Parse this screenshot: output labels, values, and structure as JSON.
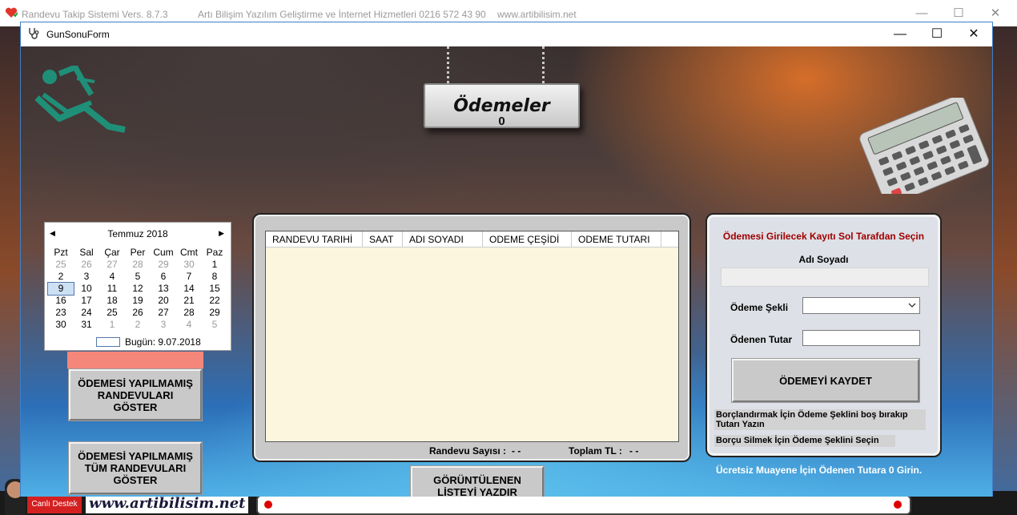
{
  "parent_window": {
    "title": "Randevu Takip Sistemi  Vers. 8.7.3",
    "company": "Artı Bilişim Yazılım Geliştirme ve İnternet Hizmetleri  0216 572 43 90",
    "website": "www.artibilisim.net",
    "live_support": "Canlı Destek",
    "footer_site": "www.artibilisim.net"
  },
  "window": {
    "title": "GunSonuForm",
    "controls": {
      "minimize": "—",
      "maximize": "☐",
      "close": "✕"
    }
  },
  "sign": {
    "title": "Ödemeler",
    "count": "0"
  },
  "calendar": {
    "month_label": "Temmuz 2018",
    "weekdays": [
      "Pzt",
      "Sal",
      "Çar",
      "Per",
      "Cum",
      "Cmt",
      "Paz"
    ],
    "weeks": [
      [
        "25",
        "26",
        "27",
        "28",
        "29",
        "30",
        "1"
      ],
      [
        "2",
        "3",
        "4",
        "5",
        "6",
        "7",
        "8"
      ],
      [
        "9",
        "10",
        "11",
        "12",
        "13",
        "14",
        "15"
      ],
      [
        "16",
        "17",
        "18",
        "19",
        "20",
        "21",
        "22"
      ],
      [
        "23",
        "24",
        "25",
        "26",
        "27",
        "28",
        "29"
      ],
      [
        "30",
        "31",
        "1",
        "2",
        "3",
        "4",
        "5"
      ]
    ],
    "selected_day": "9",
    "today_label": "Bugün: 9.07.2018"
  },
  "buttons": {
    "unpaid_filtered": "ÖDEMESİ YAPILMAMIŞ\nRANDEVULARI\nGÖSTER",
    "unpaid_all": "ÖDEMESİ YAPILMAMIŞ\nTÜM RANDEVULARI\nGÖSTER",
    "print_list": "GÖRÜNTÜLENEN\nLİSTEYİ YAZDIR",
    "save_payment": "ÖDEMEYİ KAYDET"
  },
  "grid": {
    "columns": [
      "RANDEVU TARIHİ",
      "SAAT",
      "ADI SOYADI",
      "ODEME ÇEŞİDİ",
      "ODEME TUTARI"
    ],
    "rows": []
  },
  "summary": {
    "count_label": "Randevu Sayısı :",
    "count_value": "- -",
    "total_label": "Toplam TL :",
    "total_value": "- -"
  },
  "payment_form": {
    "instruction": "Ödemesi Girilecek Kayıtı Sol Tarafdan Seçin",
    "name_label": "Adı Soyadı",
    "name_value": "",
    "payment_type_label": "Ödeme Şekli",
    "payment_type_value": "",
    "amount_label": "Ödenen Tutar",
    "amount_value": "",
    "note_debt": "Borçlandırmak İçin Ödeme Şeklini boş bırakıp Tutarı Yazın",
    "note_clear": "Borçu Silmek İçin Ödeme Şeklini Seçin"
  },
  "free_exam_note": "Ücretsiz Muayene İçin Ödenen Tutara 0 Girin.",
  "colors": {
    "accent_red": "#a00000",
    "salmon": "#f5877a",
    "grid_bg": "#fdf6df",
    "teal_icon": "#1f8f78"
  }
}
